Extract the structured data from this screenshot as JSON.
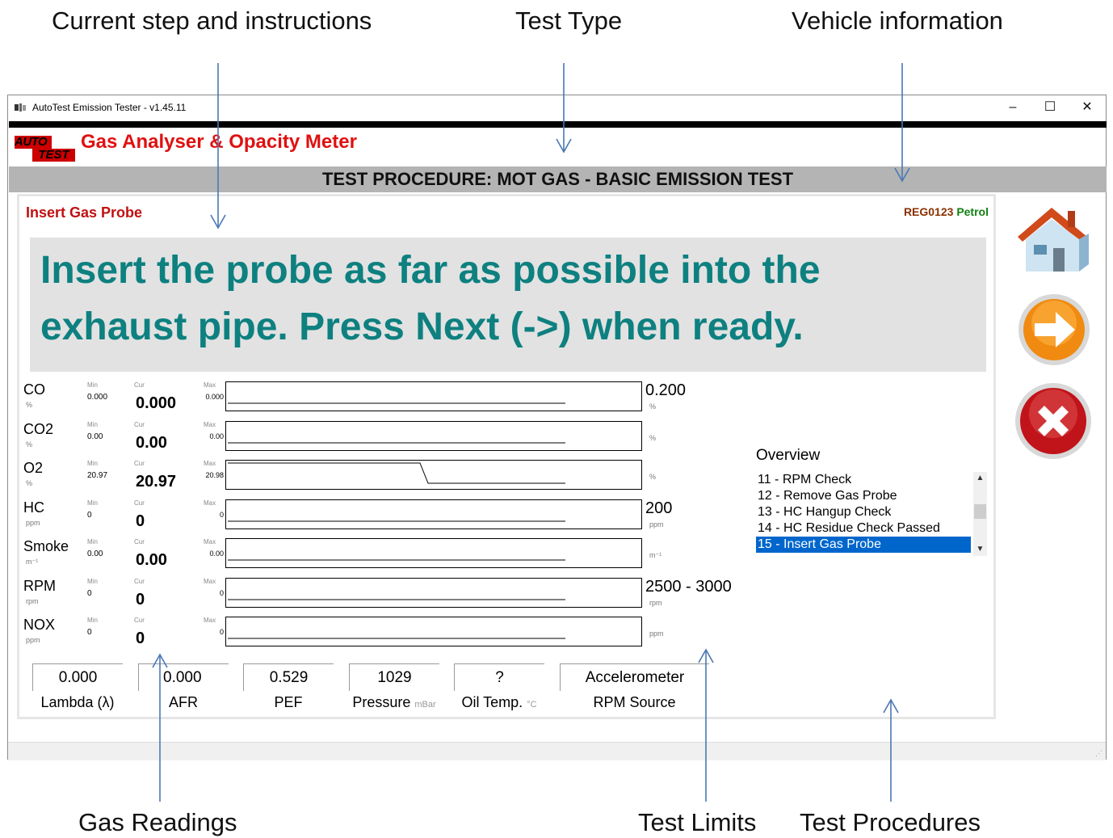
{
  "annotations": {
    "current_step": "Current step and instructions",
    "test_type": "Test Type",
    "vehicle_info": "Vehicle information",
    "gas_readings": "Gas Readings",
    "test_limits": "Test Limits",
    "test_procedures": "Test Procedures"
  },
  "window": {
    "title": "AutoTest Emission Tester - v1.45.11",
    "minimize": "–",
    "maximize": "☐",
    "close": "✕"
  },
  "header": {
    "logo_top": "AUTO",
    "logo_bottom": "TEST",
    "app_title": "Gas Analyser & Opacity Meter",
    "procedure": "TEST PROCEDURE: MOT GAS - BASIC EMISSION TEST"
  },
  "step": {
    "title": "Insert Gas Probe",
    "instruction": "Insert the probe as far as possible into the exhaust pipe. Press Next (->) when ready."
  },
  "vehicle": {
    "registration": "REG0123",
    "fuel": "Petrol"
  },
  "readings_labels": {
    "min": "Min",
    "cur": "Cur",
    "max": "Max"
  },
  "readings": [
    {
      "name": "CO",
      "unit": "%",
      "min": "0.000",
      "cur": "0.000",
      "max": "0.000",
      "limit": "0.200",
      "limit_unit": "%"
    },
    {
      "name": "CO2",
      "unit": "%",
      "min": "0.00",
      "cur": "0.00",
      "max": "0.00",
      "limit": "",
      "limit_unit": "%"
    },
    {
      "name": "O2",
      "unit": "%",
      "min": "20.97",
      "cur": "20.97",
      "max": "20.98",
      "limit": "",
      "limit_unit": "%"
    },
    {
      "name": "HC",
      "unit": "ppm",
      "min": "0",
      "cur": "0",
      "max": "0",
      "limit": "200",
      "limit_unit": "ppm"
    },
    {
      "name": "Smoke",
      "unit": "m⁻¹",
      "min": "0.00",
      "cur": "0.00",
      "max": "0.00",
      "limit": "",
      "limit_unit": "m⁻¹"
    },
    {
      "name": "RPM",
      "unit": "rpm",
      "min": "0",
      "cur": "0",
      "max": "0",
      "limit": "2500 - 3000",
      "limit_unit": "rpm"
    },
    {
      "name": "NOX",
      "unit": "ppm",
      "min": "0",
      "cur": "0",
      "max": "0",
      "limit": "",
      "limit_unit": "ppm"
    }
  ],
  "bottom": [
    {
      "value": "0.000",
      "label": "Lambda (λ)",
      "unit": ""
    },
    {
      "value": "0.000",
      "label": "AFR",
      "unit": ""
    },
    {
      "value": "0.529",
      "label": "PEF",
      "unit": ""
    },
    {
      "value": "1029",
      "label": "Pressure",
      "unit": "mBar"
    },
    {
      "value": "?",
      "label": "Oil Temp.",
      "unit": "°C"
    },
    {
      "value": "Accelerometer",
      "label": "RPM Source",
      "unit": ""
    }
  ],
  "overview": {
    "label": "Overview",
    "items": [
      "11 - RPM Check",
      "12 - Remove Gas Probe",
      "13 - HC Hangup Check",
      "14 - HC Residue Check Passed",
      "15 - Insert Gas Probe"
    ],
    "selected": 4
  },
  "buttons": {
    "home": "home-icon",
    "next": "arrow-right-icon",
    "cancel": "cancel-icon"
  },
  "colors": {
    "app_title": "#e01010",
    "instruction_text": "#0e8080",
    "step_title": "#c01010",
    "selection": "#0066cc"
  }
}
